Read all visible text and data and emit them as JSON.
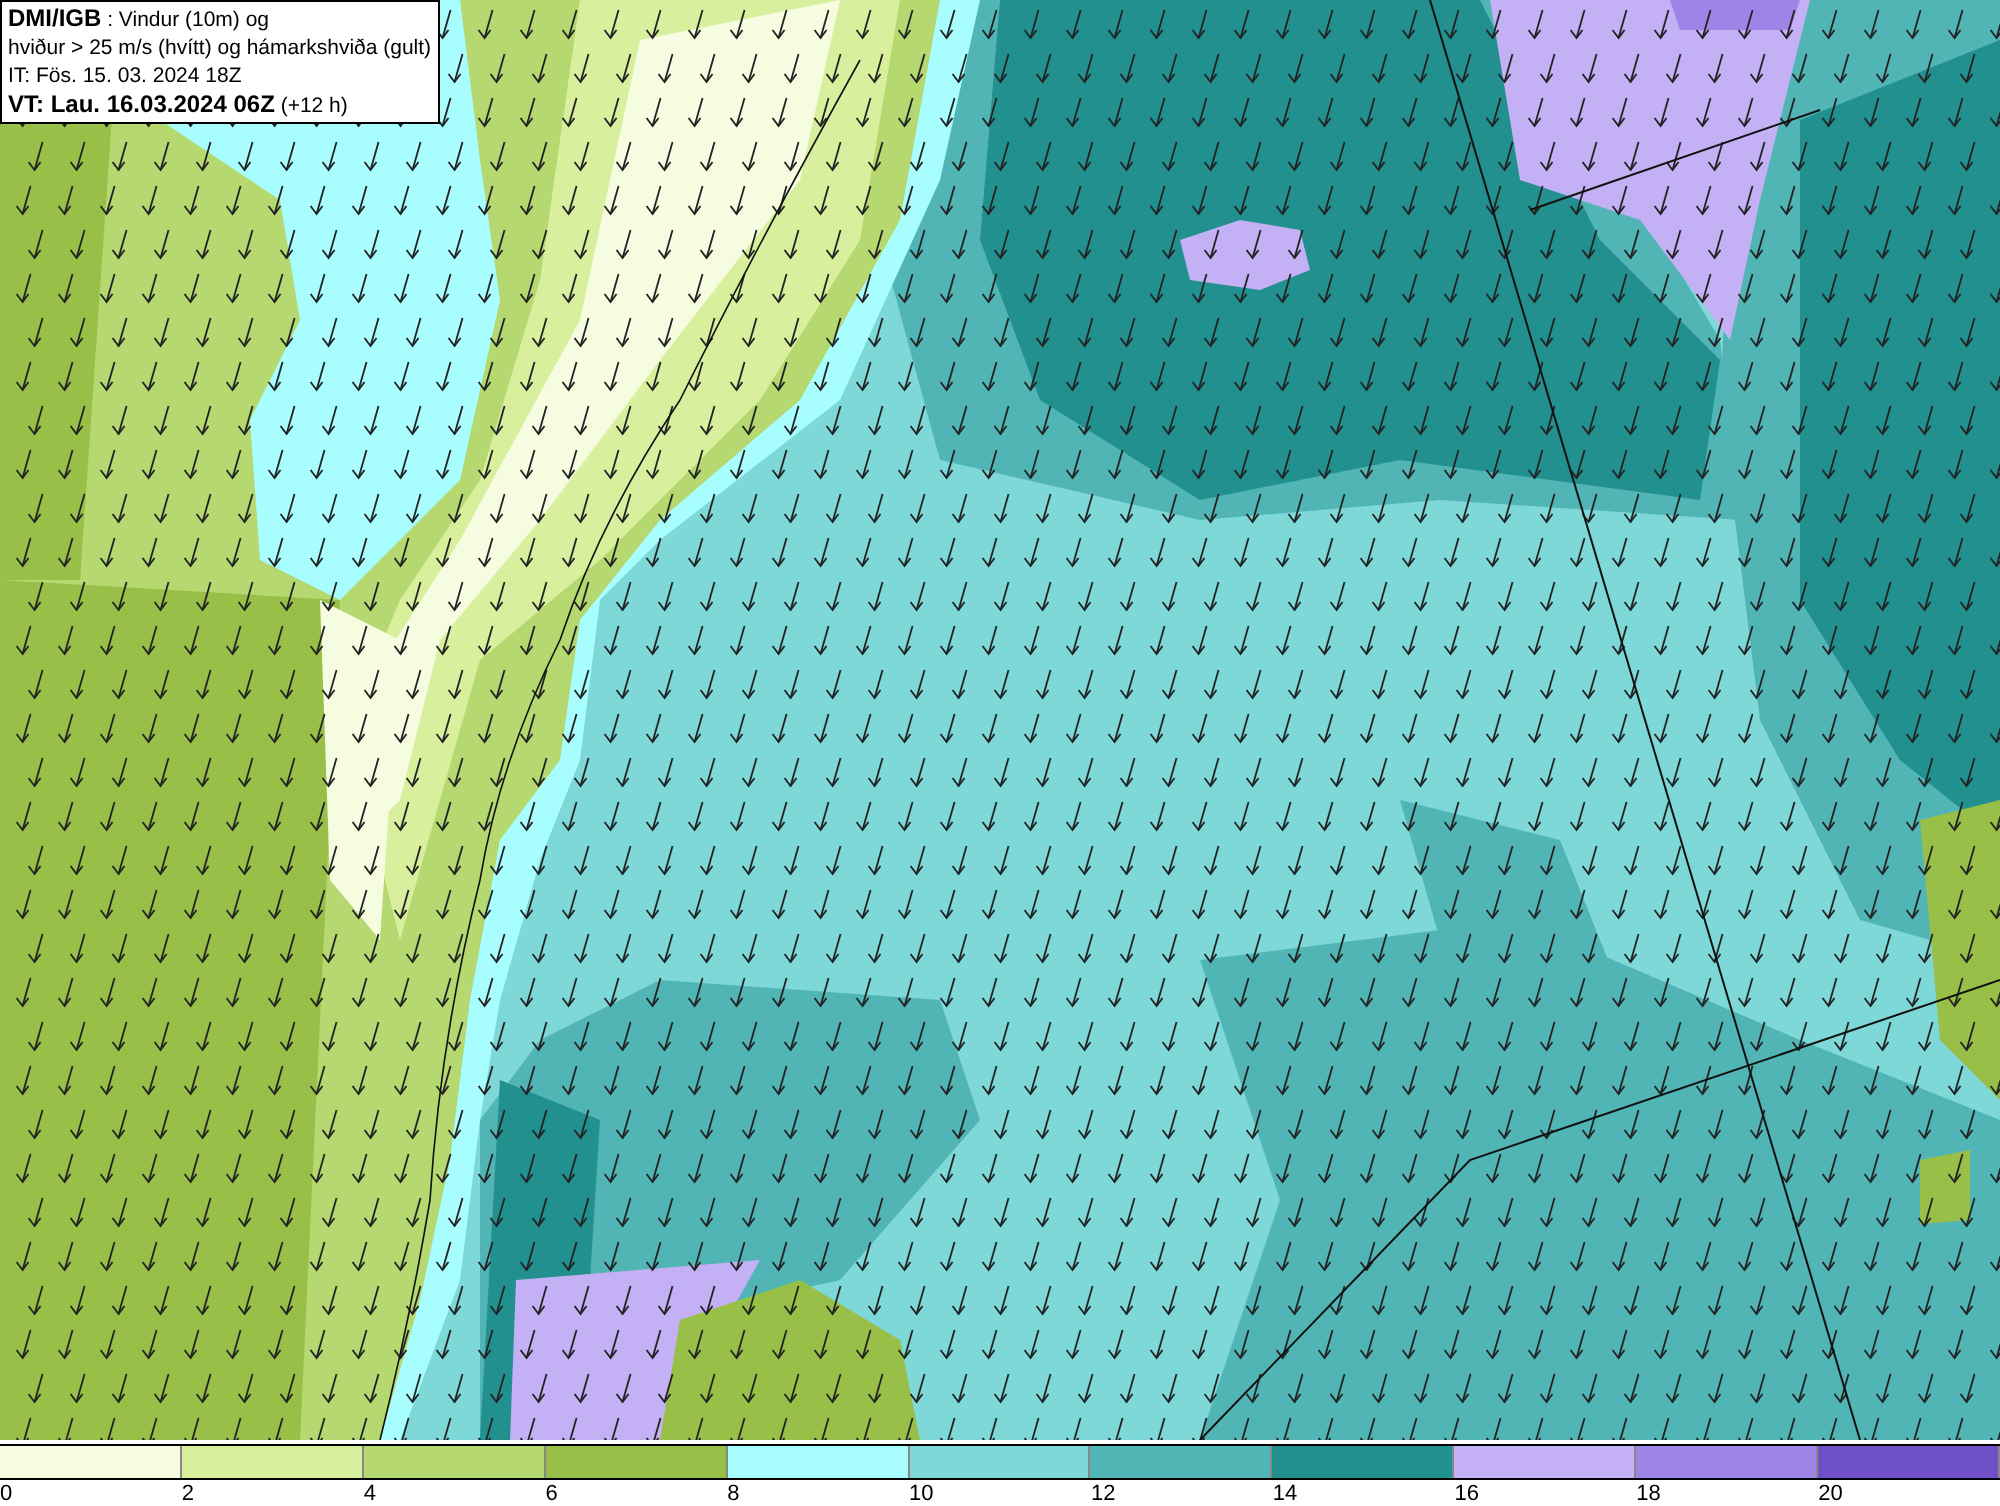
{
  "title_box": {
    "lines": [
      "**DMI/IGB** : Vindur (10m) og",
      "hviður > 25 m/s (hvítt) og hámarkshviða (gult)",
      "IT: Fös. 15. 03. 2024 18Z",
      "**VT: Lau. 16.03.2024 06Z** (+12 h)"
    ]
  },
  "legend": {
    "bins": [
      {
        "color": "#f5fce0"
      },
      {
        "color": "#d8ef9e"
      },
      {
        "color": "#b5d870"
      },
      {
        "color": "#98c048"
      },
      {
        "color": "#a8fefe"
      },
      {
        "color": "#7fd8d8"
      },
      {
        "color": "#52b5b5"
      },
      {
        "color": "#22908e"
      },
      {
        "color": "#c4b0f5"
      },
      {
        "color": "#9e84e6"
      },
      {
        "color": "#7050c8"
      }
    ],
    "ticks": [
      "0",
      "2",
      "4",
      "6",
      "8",
      "10",
      "12",
      "14",
      "16",
      "18",
      "20"
    ]
  }
}
